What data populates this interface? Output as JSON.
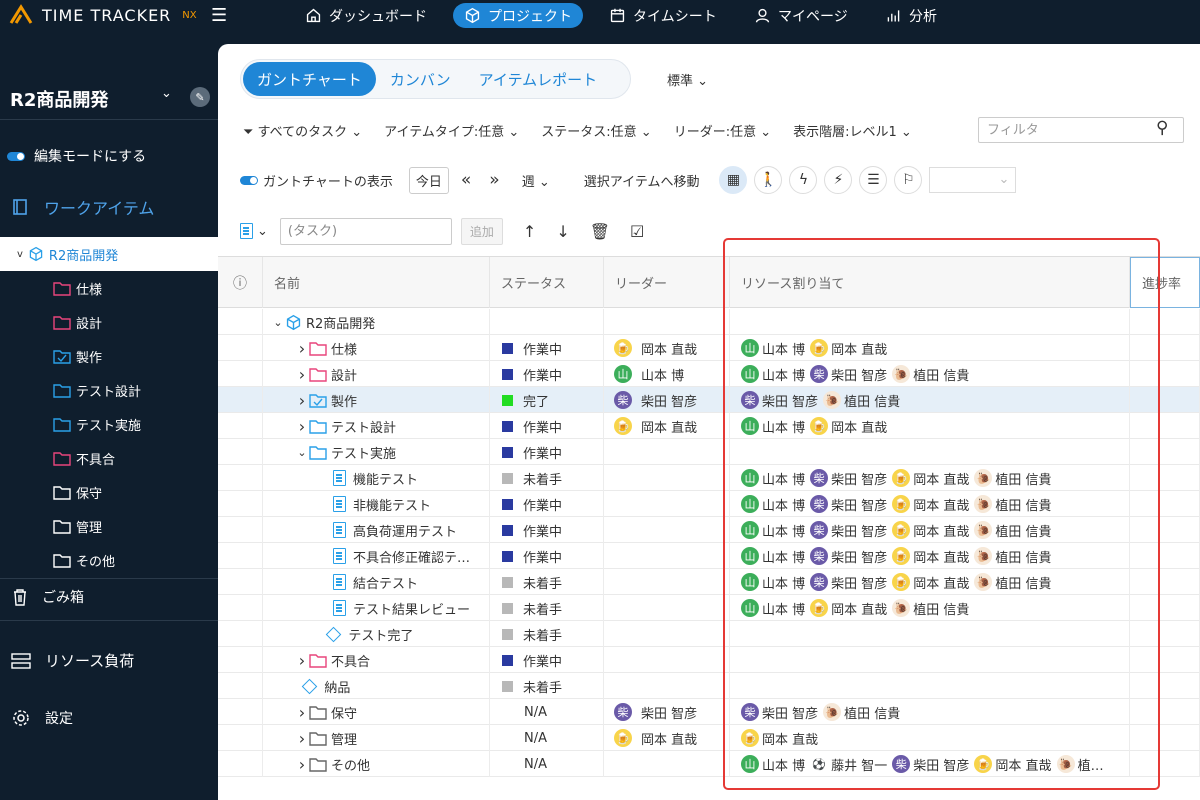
{
  "app": {
    "brand": "TIME TRACKER",
    "brand_suffix": "NX"
  },
  "topnav": {
    "items": [
      {
        "label": "ダッシュボード",
        "icon": "home-icon",
        "active": false
      },
      {
        "label": "プロジェクト",
        "icon": "cube-icon",
        "active": true
      },
      {
        "label": "タイムシート",
        "icon": "calendar-icon",
        "active": false
      },
      {
        "label": "マイページ",
        "icon": "user-icon",
        "active": false
      },
      {
        "label": "分析",
        "icon": "bar-chart-icon",
        "active": false
      }
    ]
  },
  "sidebar": {
    "project_name": "R2商品開発",
    "edit_mode_label": "編集モードにする",
    "work_items_label": "ワークアイテム",
    "tree_root": "R2商品開発",
    "tree_children": [
      {
        "label": "仕様",
        "color": "#e8457c"
      },
      {
        "label": "設計",
        "color": "#e8457c"
      },
      {
        "label": "製作",
        "color": "#2aa0e8"
      },
      {
        "label": "テスト設計",
        "color": "#2aa0e8"
      },
      {
        "label": "テスト実施",
        "color": "#2aa0e8"
      },
      {
        "label": "不具合",
        "color": "#e8457c"
      },
      {
        "label": "保守",
        "color": "#ffffff"
      },
      {
        "label": "管理",
        "color": "#ffffff"
      },
      {
        "label": "その他",
        "color": "#ffffff"
      }
    ],
    "trash_label": "ごみ箱",
    "resource_label": "リソース負荷",
    "settings_label": "設定"
  },
  "view_tabs": {
    "items": [
      "ガントチャート",
      "カンバン",
      "アイテムレポート"
    ],
    "active": 0
  },
  "standard_label": "標準",
  "filters": {
    "items": [
      "すべてのタスク",
      "アイテムタイプ:任意",
      "ステータス:任意",
      "リーダー:任意",
      "表示階層:レベル1"
    ],
    "search_placeholder": "フィルタ"
  },
  "toolbar": {
    "gantt_toggle_label": "ガントチャートの表示",
    "today_label": "今日",
    "period_label": "週",
    "move_label": "選択アイテムへ移動"
  },
  "task_bar": {
    "placeholder": "(タスク)",
    "add_label": "追加"
  },
  "grid": {
    "headers": {
      "info": "ⓘ",
      "name": "名前",
      "status": "ステータス",
      "leader": "リーダー",
      "resources": "リソース割り当て",
      "progress": "進捗率"
    },
    "status_colors": {
      "作業中": "#2a3aa0",
      "完了": "#22dd22",
      "未着手": "#b8b8b8",
      "N/A": ""
    },
    "people": {
      "山本 博": {
        "glyph": "山",
        "color": "#3cae5a"
      },
      "岡本 直哉": {
        "glyph": "🍺",
        "color": "#f8d44a"
      },
      "柴田 智彦": {
        "glyph": "柴",
        "color": "#6a5aa8"
      },
      "植田 信貴": {
        "glyph": "🐌",
        "color": "#f6e8d8"
      },
      "藤井 智一": {
        "glyph": "⚽",
        "color": "#ffffff"
      }
    },
    "rows": [
      {
        "depth": 0,
        "expand": "v",
        "type": "cube",
        "color": "#2aa0e8",
        "name": "R2商品開発",
        "status": "",
        "leader": "",
        "resources": []
      },
      {
        "depth": 1,
        "expand": ">",
        "type": "folder",
        "color": "#e8457c",
        "name": "仕様",
        "status": "作業中",
        "leader": "岡本 直哉",
        "resources": [
          "山本 博",
          "岡本 直哉"
        ]
      },
      {
        "depth": 1,
        "expand": ">",
        "type": "folder",
        "color": "#e8457c",
        "name": "設計",
        "status": "作業中",
        "leader": "山本 博",
        "resources": [
          "山本 博",
          "柴田 智彦",
          "植田 信貴"
        ]
      },
      {
        "depth": 1,
        "expand": ">",
        "type": "folder-check",
        "color": "#2aa0e8",
        "name": "製作",
        "status": "完了",
        "leader": "柴田 智彦",
        "resources": [
          "柴田 智彦",
          "植田 信貴"
        ],
        "selected": true
      },
      {
        "depth": 1,
        "expand": ">",
        "type": "folder",
        "color": "#2aa0e8",
        "name": "テスト設計",
        "status": "作業中",
        "leader": "岡本 直哉",
        "resources": [
          "山本 博",
          "岡本 直哉"
        ]
      },
      {
        "depth": 1,
        "expand": "v",
        "type": "folder",
        "color": "#2aa0e8",
        "name": "テスト実施",
        "status": "作業中",
        "leader": "",
        "resources": []
      },
      {
        "depth": 2,
        "expand": "",
        "type": "doc",
        "color": "#2aa0e8",
        "name": "機能テスト",
        "status": "未着手",
        "leader": "",
        "resources": [
          "山本 博",
          "柴田 智彦",
          "岡本 直哉",
          "植田 信貴"
        ]
      },
      {
        "depth": 2,
        "expand": "",
        "type": "doc",
        "color": "#2aa0e8",
        "name": "非機能テスト",
        "status": "作業中",
        "leader": "",
        "resources": [
          "山本 博",
          "柴田 智彦",
          "岡本 直哉",
          "植田 信貴"
        ]
      },
      {
        "depth": 2,
        "expand": "",
        "type": "doc",
        "color": "#2aa0e8",
        "name": "高負荷運用テスト",
        "status": "作業中",
        "leader": "",
        "resources": [
          "山本 博",
          "柴田 智彦",
          "岡本 直哉",
          "植田 信貴"
        ]
      },
      {
        "depth": 2,
        "expand": "",
        "type": "doc",
        "color": "#2aa0e8",
        "name": "不具合修正確認テ…",
        "status": "作業中",
        "leader": "",
        "resources": [
          "山本 博",
          "柴田 智彦",
          "岡本 直哉",
          "植田 信貴"
        ]
      },
      {
        "depth": 2,
        "expand": "",
        "type": "doc",
        "color": "#2aa0e8",
        "name": "結合テスト",
        "status": "未着手",
        "leader": "",
        "resources": [
          "山本 博",
          "柴田 智彦",
          "岡本 直哉",
          "植田 信貴"
        ]
      },
      {
        "depth": 2,
        "expand": "",
        "type": "doc",
        "color": "#2aa0e8",
        "name": "テスト結果レビュー",
        "status": "未着手",
        "leader": "",
        "resources": [
          "山本 博",
          "岡本 直哉",
          "植田 信貴"
        ]
      },
      {
        "depth": 1.6,
        "expand": "",
        "type": "diamond",
        "color": "#2aa0e8",
        "name": "テスト完了",
        "status": "未着手",
        "leader": "",
        "resources": []
      },
      {
        "depth": 1,
        "expand": ">",
        "type": "folder",
        "color": "#e8457c",
        "name": "不具合",
        "status": "作業中",
        "leader": "",
        "resources": []
      },
      {
        "depth": 0.6,
        "expand": "",
        "type": "diamond",
        "color": "#2aa0e8",
        "name": "納品",
        "status": "未着手",
        "leader": "",
        "resources": []
      },
      {
        "depth": 1,
        "expand": ">",
        "type": "folder",
        "color": "#666666",
        "name": "保守",
        "status": "N/A",
        "leader": "柴田 智彦",
        "resources": [
          "柴田 智彦",
          "植田 信貴"
        ]
      },
      {
        "depth": 1,
        "expand": ">",
        "type": "folder",
        "color": "#666666",
        "name": "管理",
        "status": "N/A",
        "leader": "岡本 直哉",
        "resources": [
          "岡本 直哉"
        ]
      },
      {
        "depth": 1,
        "expand": ">",
        "type": "folder",
        "color": "#666666",
        "name": "その他",
        "status": "N/A",
        "leader": "",
        "resources": [
          "山本 博",
          "藤井 智一",
          "柴田 智彦",
          "岡本 直哉"
        ],
        "truncated_tail": "植…"
      }
    ]
  }
}
